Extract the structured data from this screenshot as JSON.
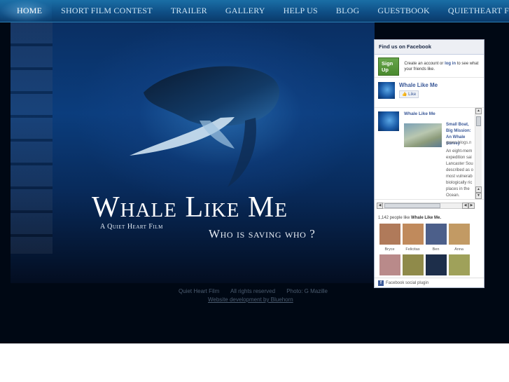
{
  "nav": {
    "items": [
      {
        "label": "HOME",
        "active": true
      },
      {
        "label": "SHORT FILM CONTEST"
      },
      {
        "label": "TRAILER"
      },
      {
        "label": "GALLERY"
      },
      {
        "label": "HELP US"
      },
      {
        "label": "BLOG"
      },
      {
        "label": "GUESTBOOK"
      },
      {
        "label": "QUIETHEART FILM"
      }
    ]
  },
  "hero": {
    "title": "Whale Like Me",
    "subtitle": "A Quiet Heart Film",
    "tagline": "Who is saving who ?"
  },
  "footer": {
    "company": "Quiet Heart Film",
    "rights": "All rights reserved",
    "photo": "Photo: G Mazille",
    "dev_link": "Website development by Bluehorn"
  },
  "facebook": {
    "header": "Find us on Facebook",
    "signup_button": "Sign Up",
    "signup_text_pre": "Create an account or",
    "signup_text_login": "log in",
    "signup_text_post": "to see what your friends like.",
    "page_name": "Whale Like Me",
    "like_button": "Like",
    "stream": {
      "author": "Whale Like Me",
      "post_title": "Small Boat, Big Mission: An Whale Survey",
      "post_source": "green.blogs.n",
      "post_body": "An eight-mem expedition sai Lancaster Sou described as o most vulnerab biologically ric places in the Ocean."
    },
    "fans_count": "1,142 people like",
    "fans_page": "Whale Like Me.",
    "fans": [
      {
        "name": "Bryce",
        "color": "#b07a5a"
      },
      {
        "name": "Felicitas",
        "color": "#c08a5c"
      },
      {
        "name": "Ben",
        "color": "#4c5f8a"
      },
      {
        "name": "Anna",
        "color": "#c29a64"
      },
      {
        "name": "",
        "color": "#b98a8a"
      },
      {
        "name": "",
        "color": "#8f8a4a"
      },
      {
        "name": "",
        "color": "#1d2e4a"
      },
      {
        "name": "",
        "color": "#9fa15a"
      }
    ],
    "plugin_label": "Facebook social plugin"
  },
  "colors": {
    "nav_bg": "#0f4f86",
    "fb_blue": "#3b5998",
    "signup_green": "#4a8a2e"
  }
}
